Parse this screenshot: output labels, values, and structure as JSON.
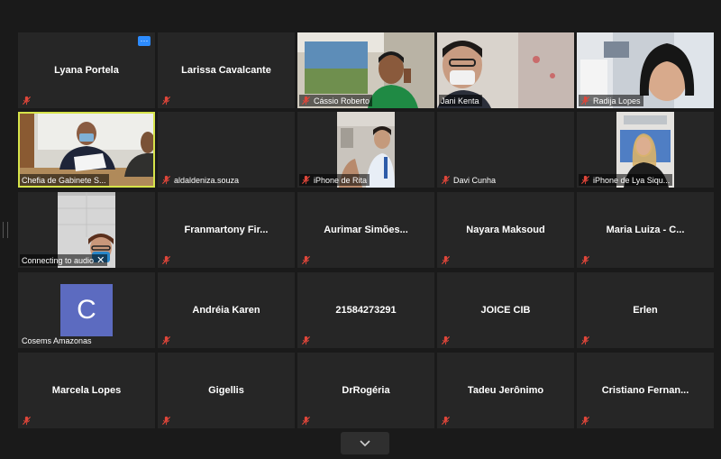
{
  "participants": [
    {
      "name": "Lyana Portela"
    },
    {
      "name": "Larissa Cavalcante"
    },
    {
      "name": "Cássio Roberto"
    },
    {
      "name": "Jani Kenta"
    },
    {
      "name": "Radija Lopes"
    },
    {
      "name": "Chefia de Gabinete S..."
    },
    {
      "name": "aldaldeniza.souza"
    },
    {
      "name": "iPhone de Rita"
    },
    {
      "name": "Davi Cunha"
    },
    {
      "name": "iPhone de Lya Siqu..."
    },
    {
      "name": "Connecting to audio"
    },
    {
      "name": "Franmartony Fir..."
    },
    {
      "name": "Aurimar Simões..."
    },
    {
      "name": "Nayara Maksoud"
    },
    {
      "name": "Maria Luiza - C..."
    },
    {
      "name": "Cosems Amazonas",
      "avatar_letter": "C"
    },
    {
      "name": "Andréia Karen"
    },
    {
      "name": "21584273291"
    },
    {
      "name": "JOICE CIB"
    },
    {
      "name": "Erlen"
    },
    {
      "name": "Marcela Lopes"
    },
    {
      "name": "Gigellis"
    },
    {
      "name": "DrRogéria"
    },
    {
      "name": "Tadeu Jerônimo"
    },
    {
      "name": "Cristiano Fernan..."
    }
  ],
  "colors": {
    "background": "#1a1a1a",
    "tile": "#262626",
    "active_speaker_border": "#d6e34a",
    "muted_icon": "#e0463a",
    "more_button": "#2d8cff",
    "avatar": "#5c6bc0"
  },
  "icons": {
    "muted": "microphone-muted-icon",
    "more": "more-options-icon",
    "close": "close-icon",
    "page_down": "chevron-down-icon"
  }
}
